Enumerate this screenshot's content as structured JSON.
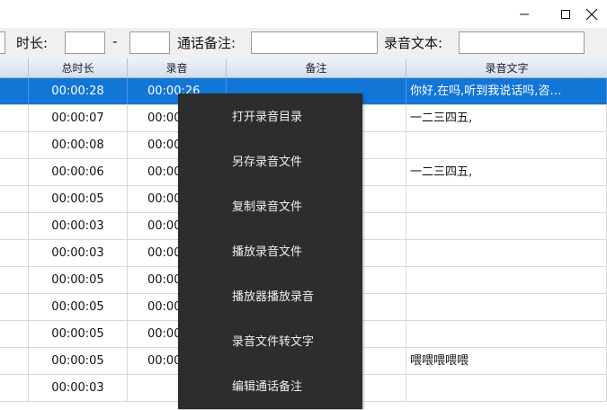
{
  "filters": {
    "duration_label": "时长:",
    "duration_dash": "-",
    "note_label": "通话备注:",
    "text_label": "录音文本:"
  },
  "grid": {
    "columns": [
      "总时长",
      "录音",
      "备注",
      "录音文字"
    ],
    "rows": [
      {
        "total": "00:00:28",
        "rec": "00:00:26",
        "note": "",
        "text": "你好,在吗,听到我说话吗,咨…",
        "selected": true
      },
      {
        "total": "00:00:07",
        "rec": "00:00",
        "note": "",
        "text": "一二三四五,"
      },
      {
        "total": "00:00:08",
        "rec": "00:00",
        "note": "",
        "text": ""
      },
      {
        "total": "00:00:06",
        "rec": "00:00",
        "note": "",
        "text": "一二三四五,"
      },
      {
        "total": "00:00:05",
        "rec": "00:00",
        "note": "",
        "text": ""
      },
      {
        "total": "00:00:03",
        "rec": "00:00",
        "note": "",
        "text": ""
      },
      {
        "total": "00:00:03",
        "rec": "00:00",
        "note": "",
        "text": ""
      },
      {
        "total": "00:00:05",
        "rec": "00:00",
        "note": "",
        "text": ""
      },
      {
        "total": "00:00:05",
        "rec": "00:00",
        "note": "",
        "text": ""
      },
      {
        "total": "00:00:05",
        "rec": "00:00",
        "note": "",
        "text": ""
      },
      {
        "total": "00:00:05",
        "rec": "00:00",
        "note": "",
        "text": "喂喂喂喂喂"
      },
      {
        "total": "00:00:03",
        "rec": "",
        "note": "",
        "text": ""
      }
    ]
  },
  "context_menu": {
    "items": [
      "打开录音目录",
      "另存录音文件",
      "复制录音文件",
      "播放录音文件",
      "播放器播放录音",
      "录音文件转文字",
      "编辑通话备注"
    ]
  },
  "colors": {
    "selection": "#1276d7",
    "menu_background": "#2d2d2d"
  }
}
